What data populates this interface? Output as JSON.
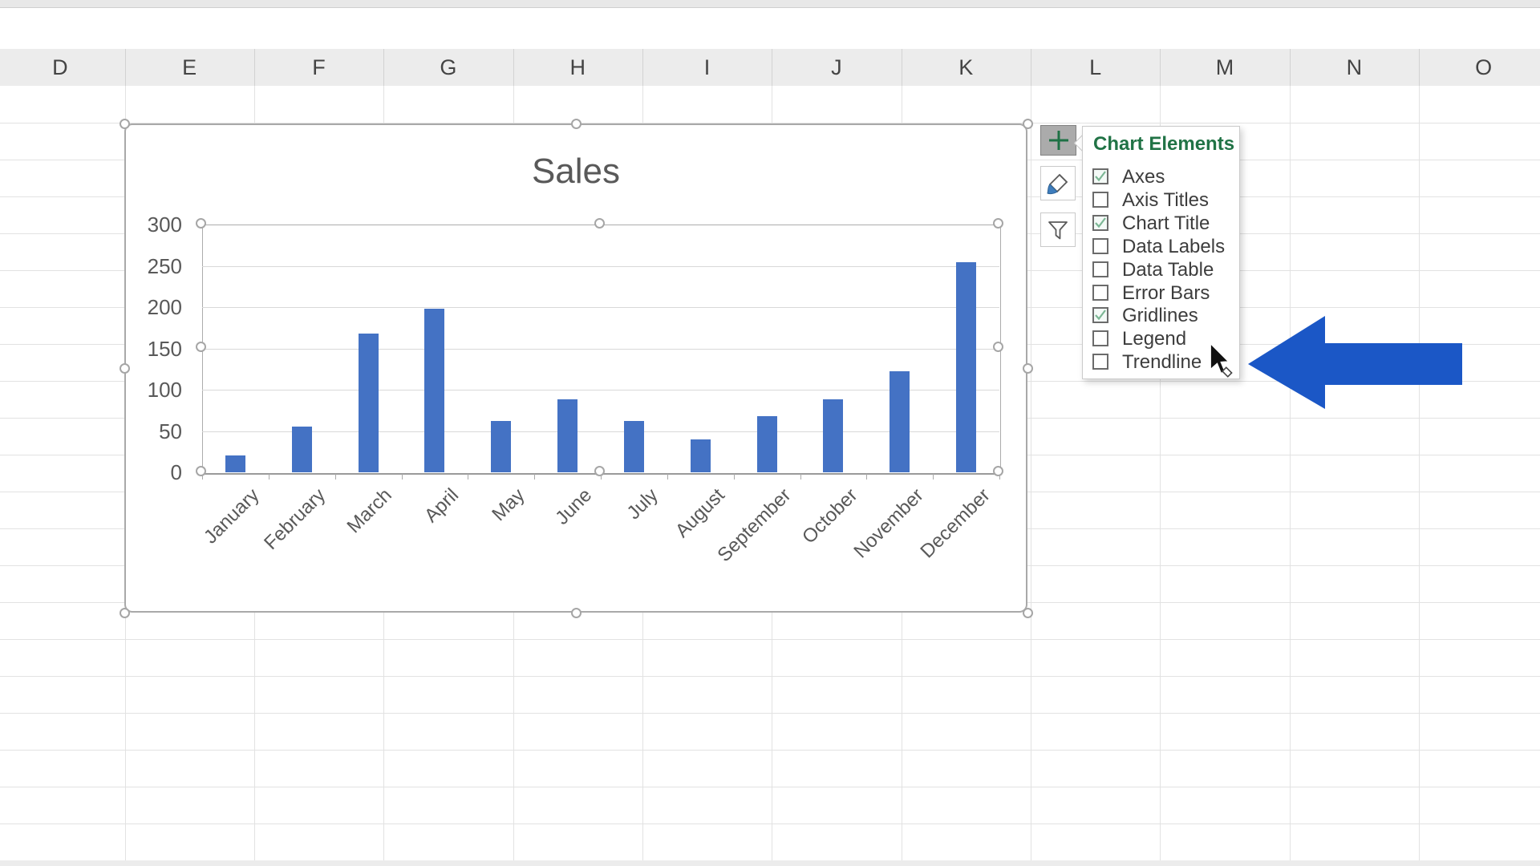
{
  "sheet": {
    "columns": [
      "D",
      "E",
      "F",
      "G",
      "H",
      "I",
      "J",
      "K",
      "L",
      "M",
      "N",
      "O"
    ]
  },
  "chart_data": {
    "type": "bar",
    "title": "Sales",
    "categories": [
      "January",
      "February",
      "March",
      "April",
      "May",
      "June",
      "July",
      "August",
      "September",
      "October",
      "November",
      "December"
    ],
    "values": [
      20,
      55,
      168,
      198,
      62,
      88,
      62,
      40,
      68,
      88,
      122,
      254
    ],
    "xlabel": "",
    "ylabel": "",
    "ylim": [
      0,
      300
    ],
    "y_ticks": [
      300,
      250,
      200,
      150,
      100,
      50,
      0
    ],
    "grid": "horizontal gridlines on",
    "legend": "none",
    "series_color": "#4472C4"
  },
  "chart_elements_panel": {
    "title": "Chart Elements",
    "items": [
      {
        "label": "Axes",
        "checked": true
      },
      {
        "label": "Axis Titles",
        "checked": false
      },
      {
        "label": "Chart Title",
        "checked": true
      },
      {
        "label": "Data Labels",
        "checked": false
      },
      {
        "label": "Data Table",
        "checked": false
      },
      {
        "label": "Error Bars",
        "checked": false
      },
      {
        "label": "Gridlines",
        "checked": true
      },
      {
        "label": "Legend",
        "checked": false
      },
      {
        "label": "Trendline",
        "checked": false
      }
    ]
  },
  "flyout_buttons": {
    "add": "chart-elements-plus",
    "style": "chart-styles-brush",
    "filter": "chart-filters-funnel"
  },
  "colors": {
    "bar": "#4472C4",
    "arrow_blue": "#1B57C6",
    "panel_green": "#217346",
    "check_green": "#7CB795",
    "checkbox_border": "#6B6B6B",
    "axis_text": "#595959",
    "header_text": "#444444",
    "sheet_grid": "#E2E2E2",
    "chart_gridline": "#D9D9D9",
    "chart_border": "#A9A9A9",
    "plus_green": "#1E7145",
    "icon_gray": "#5A5A5A",
    "brush_blue": "#3E7DBD"
  }
}
